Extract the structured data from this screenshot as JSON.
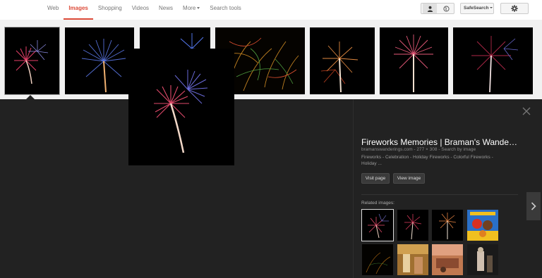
{
  "nav": {
    "tabs": [
      {
        "label": "Web"
      },
      {
        "label": "Images"
      },
      {
        "label": "Shopping"
      },
      {
        "label": "Videos"
      },
      {
        "label": "News"
      },
      {
        "label": "More"
      },
      {
        "label": "Search tools"
      }
    ],
    "safesearch_label": "SafeSearch"
  },
  "preview": {
    "title": "Fireworks Memories | Braman's Wande…",
    "source": "bramanswanderings.com",
    "dimensions": "277 × 308",
    "search_by_image": "Search by image",
    "meta_sep": " - ",
    "tags": "Fireworks - Celebration - Holiday Fireworks - Colorful Fireworks - Holiday ...",
    "visit_page": "Visit page",
    "view_image": "View image",
    "related_label": "Related images:"
  },
  "colors": {
    "accent": "#dd4b39",
    "panel_bg": "#222222",
    "page_bg": "#f1f1f1"
  }
}
